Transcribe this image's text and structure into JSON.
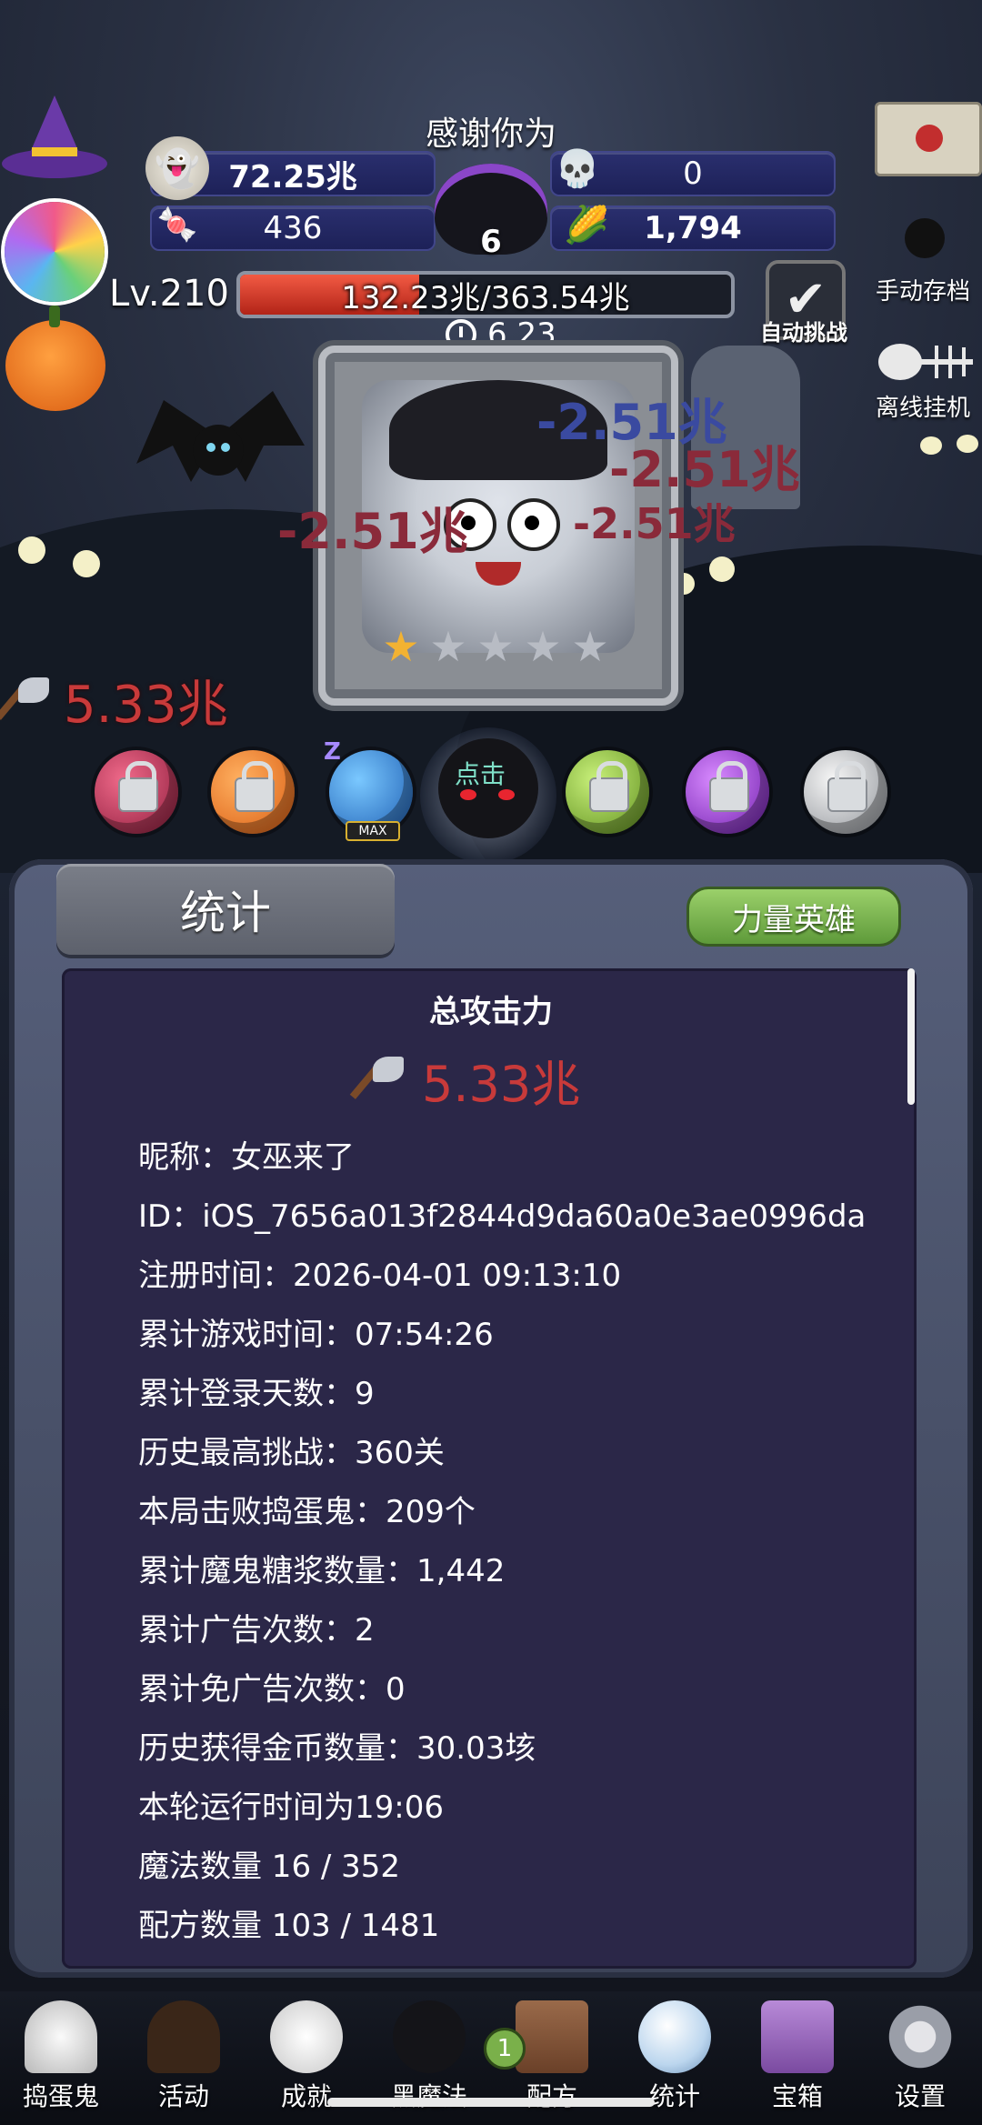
{
  "header": {
    "thanks_text": "感谢你为",
    "gold": "72.25兆",
    "skull_currency": "0",
    "candy_red": "436",
    "cauldron_count": "6",
    "candy_corn": "1,794",
    "level": "Lv.210",
    "hp_text": "132.23兆/363.54兆",
    "hp_fraction": 0.364,
    "timer": "6.23",
    "auto_challenge_label": "自动挑战",
    "manual_save_label": "手动存档",
    "offline_idle_label": "离线挂机"
  },
  "battle": {
    "damage_popups": [
      "-2.51兆",
      "-2.51兆",
      "-2.51兆",
      "-2.51兆"
    ],
    "attack_power": "5.33兆",
    "boss_stars_filled": 1,
    "boss_stars_total": 5,
    "tap_label": "点击",
    "max_label": "MAX",
    "sleep_label": "Z"
  },
  "stats": {
    "title": "统计",
    "hero_button": "力量英雄",
    "total_attack_label": "总攻击力",
    "total_attack_value": "5.33兆",
    "lines": [
      "昵称：女巫来了",
      "ID：iOS_7656a013f2844d9da60a0e3ae0996da",
      "注册时间：2026-04-01 09:13:10",
      "累计游戏时间：07:54:26",
      "累计登录天数：9",
      "历史最高挑战：360关",
      "本局击败捣蛋鬼：209个",
      "累计魔鬼糖浆数量：1,442",
      "累计广告次数：2",
      "累计免广告次数：0",
      "历史获得金币数量：30.03垓",
      "本轮运行时间为19:06",
      "魔法数量 16 / 352",
      "配方数量 103 / 1481"
    ]
  },
  "nav": {
    "items": [
      "捣蛋鬼",
      "活动",
      "成就",
      "黑魔法",
      "配方",
      "统计",
      "宝箱",
      "设置"
    ],
    "recipe_badge": "1"
  },
  "colors": {
    "damage_red": "#c83a3a",
    "panel_bg": "#2b2748",
    "hero_green": "#7cba4e"
  }
}
